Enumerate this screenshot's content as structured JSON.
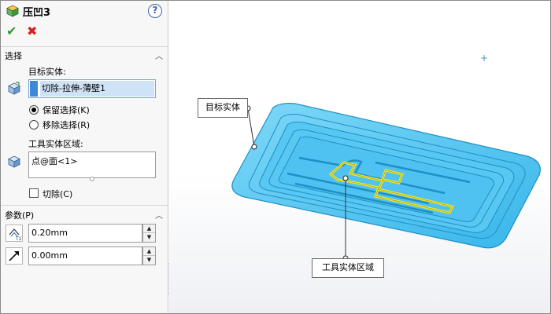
{
  "header": {
    "title": "压凹3",
    "help": "?"
  },
  "actions": {
    "ok": "✔",
    "cancel": "✖"
  },
  "selection": {
    "section_title": "选择",
    "target_label": "目标实体:",
    "target_value": "切除-拉伸-薄壁1",
    "keep_label": "保留选择(K)",
    "remove_label": "移除选择(R)",
    "selected_option": "keep",
    "tool_label": "工具实体区域:",
    "tool_value": "点@面<1>",
    "cut_label": "切除(C)",
    "cut_checked": false
  },
  "parameters": {
    "section_title": "参数(P)",
    "thickness": "0.20mm",
    "clearance": "0.00mm"
  },
  "viewport": {
    "callout_target": "目标实体",
    "callout_tool": "工具实体区域",
    "part_color": "#49c4f2",
    "highlight_color": "#f2ea2a"
  }
}
